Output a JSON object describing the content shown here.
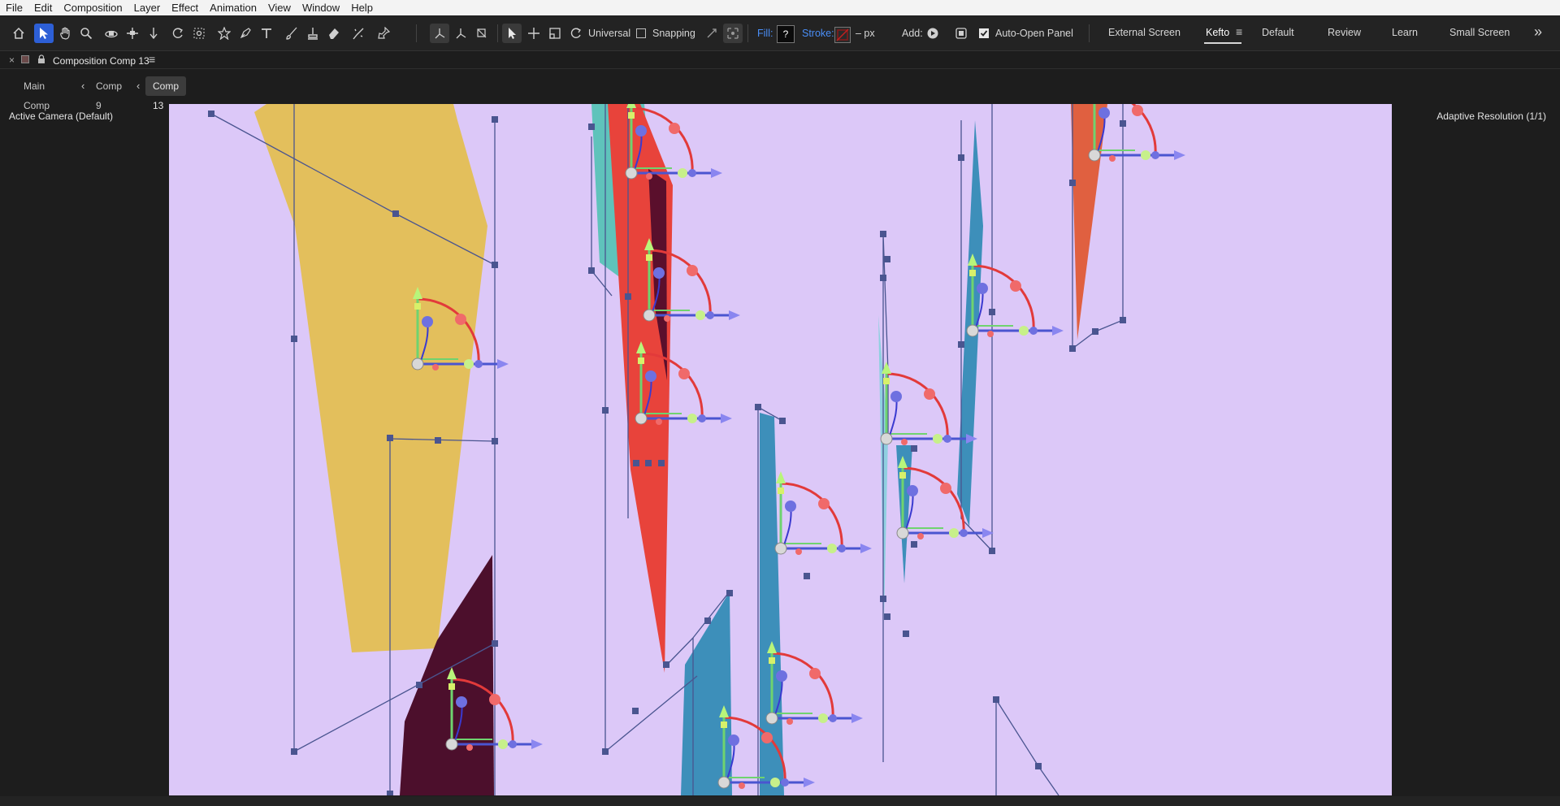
{
  "menu": [
    "File",
    "Edit",
    "Composition",
    "Layer",
    "Effect",
    "Animation",
    "View",
    "Window",
    "Help"
  ],
  "toolbar": {
    "universal_label": "Universal",
    "snapping_label": "Snapping",
    "snapping_checked": false,
    "fill_label": "Fill:",
    "fill_value": "?",
    "stroke_label": "Stroke:",
    "stroke_units": "– px",
    "add_label": "Add:",
    "auto_open_label": "Auto-Open Panel",
    "auto_open_checked": true
  },
  "workspaces": [
    "External Screen",
    "Kefto",
    "Default",
    "Review",
    "Learn",
    "Small Screen"
  ],
  "workspace_selected": "Kefto",
  "workspace_more": "»",
  "panel": {
    "close": "×",
    "title": "Composition Comp 13",
    "menu_glyph": "≡"
  },
  "breadcrumbs": [
    "Main Comp",
    "Comp 9",
    "Comp 13"
  ],
  "viewer": {
    "camera_label": "Active Camera (Default)",
    "resolution_label": "Adaptive Resolution (1/1)"
  },
  "colors": {
    "canvas_bg": "#dcc8f8",
    "yellow_shape": "#e3bf5c",
    "red_shape": "#e8433b",
    "teal_shape": "#5fc3bb",
    "blue_shape": "#3d8fba",
    "light_blue_shape": "#8fd0e0",
    "dark_maroon": "#4c0f2c",
    "orange_shape": "#e06040",
    "accent_blue": "#2d5fd6"
  }
}
